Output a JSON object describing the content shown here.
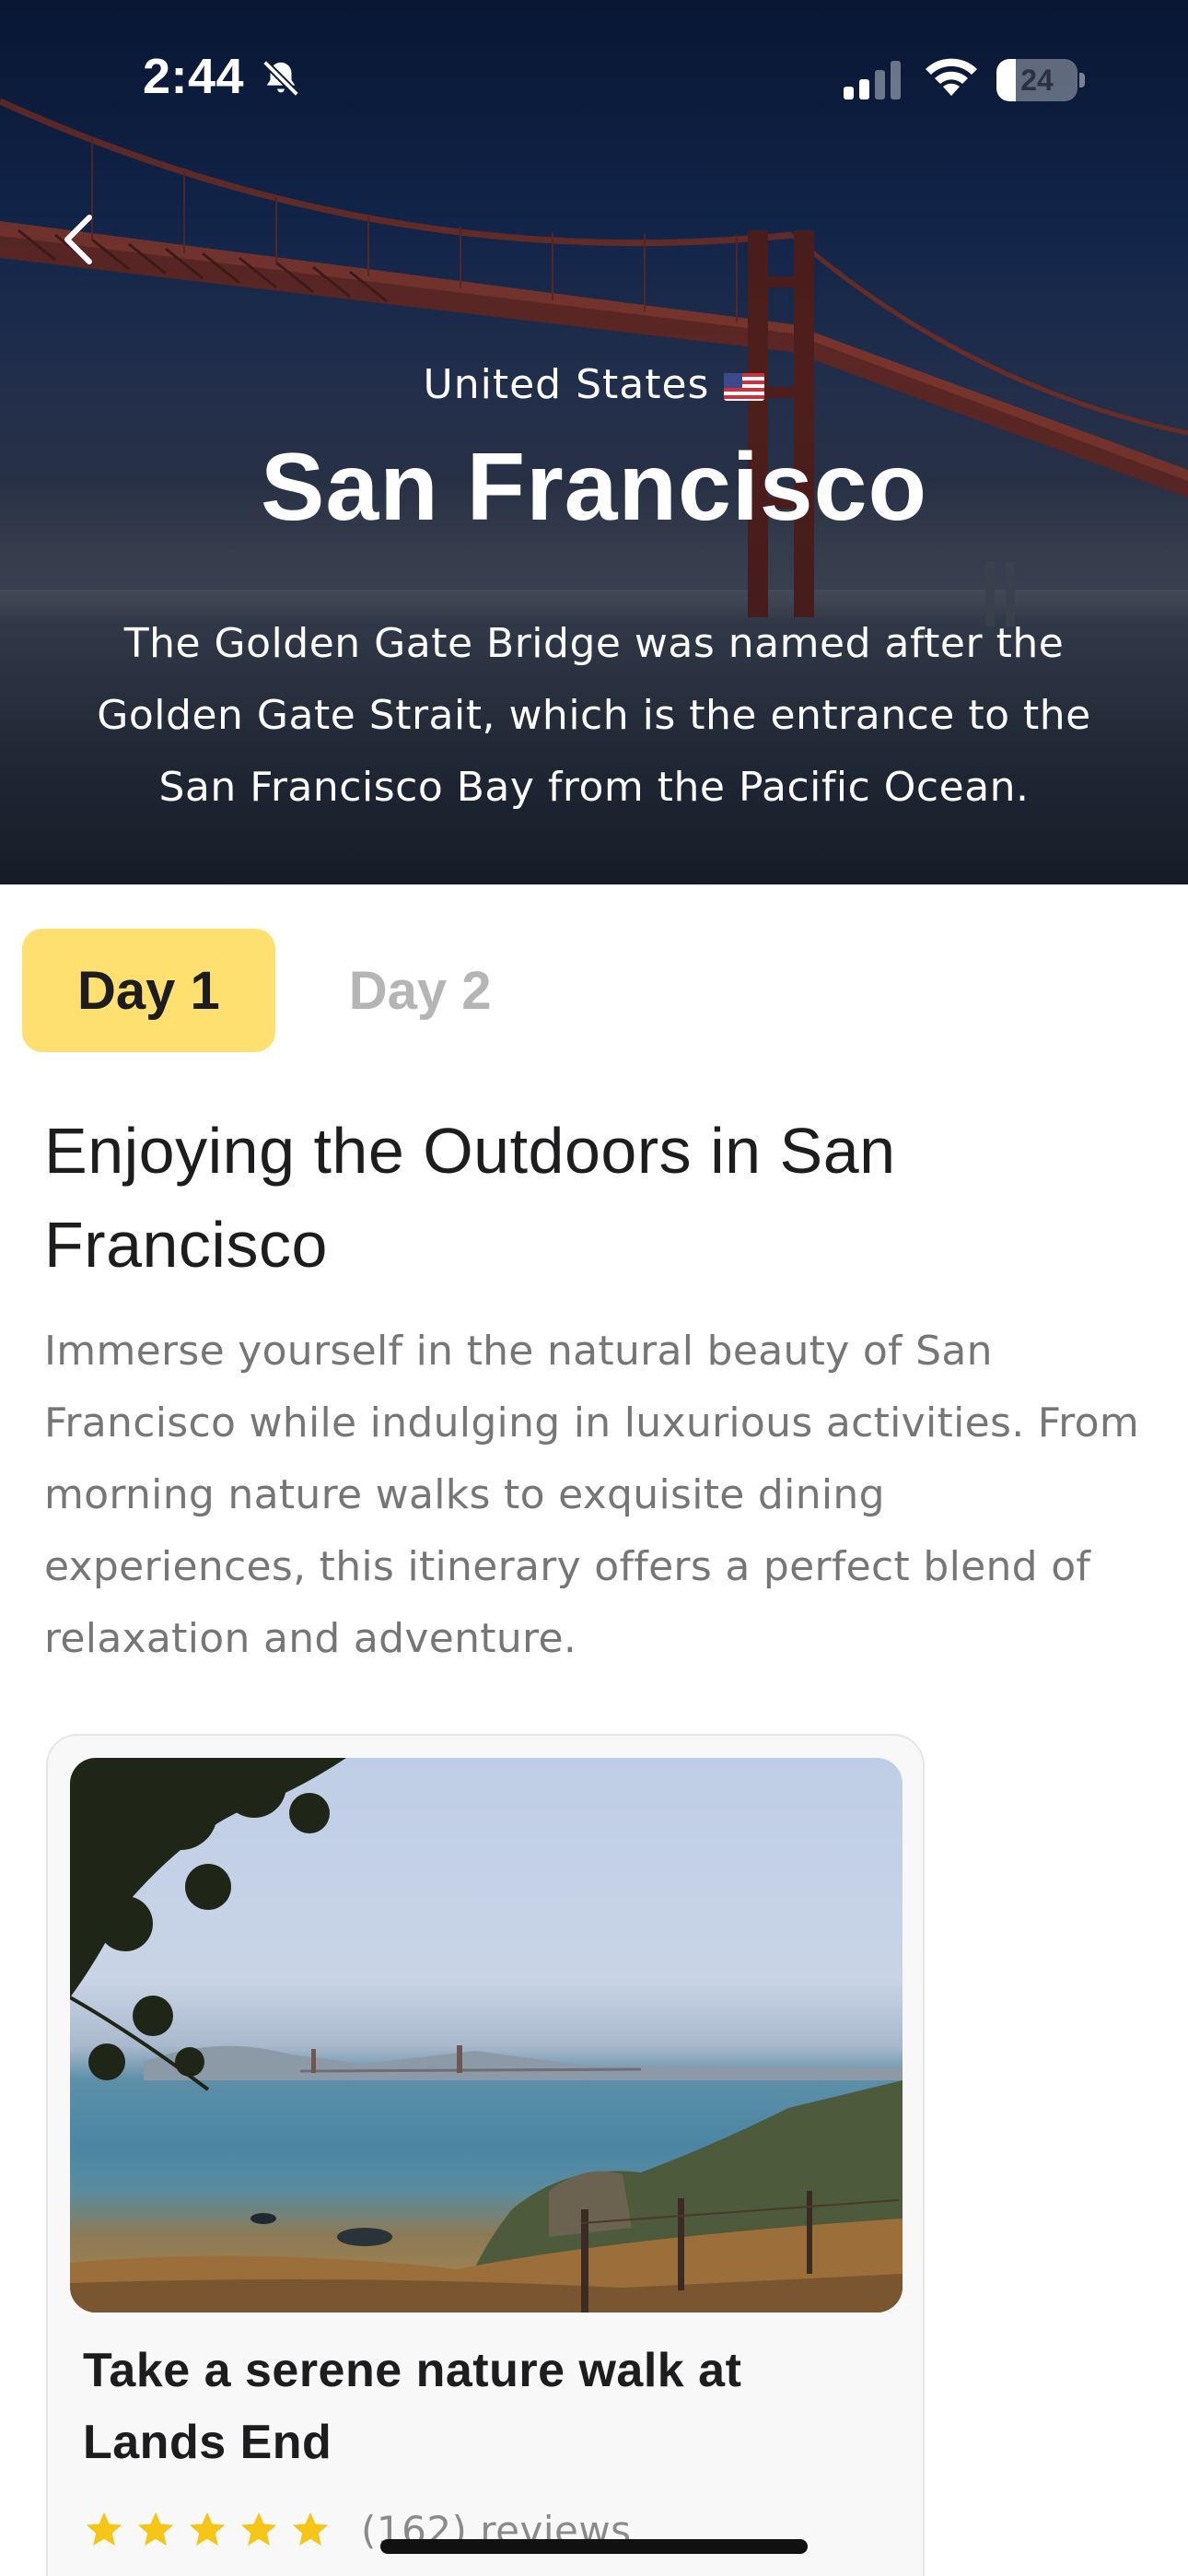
{
  "status_bar": {
    "time": "2:44",
    "battery_level": 24,
    "battery_text": "24",
    "icons": [
      "bell-slash-icon",
      "cellular-signal-icon",
      "wifi-icon",
      "battery-icon"
    ]
  },
  "hero": {
    "country": "United States",
    "flag": "us-flag-icon",
    "city": "San Francisco",
    "description": "The Golden Gate Bridge was named after the Golden Gate Strait, which is the entrance to the San Francisco Bay from the Pacific Ocean."
  },
  "tabs": [
    {
      "label": "Day 1",
      "active": true
    },
    {
      "label": "Day 2",
      "active": false
    }
  ],
  "day": {
    "title": "Enjoying the Outdoors in San Francisco",
    "description": "Immerse yourself in the natural beauty of San Francisco while indulging in luxurious activities. From morning nature walks to exquisite dining experiences, this itinerary offers a perfect blend of relaxation and adventure."
  },
  "activity": {
    "title": "Take a serene nature walk at Lands End",
    "rating": 5,
    "reviews": "(162) reviews"
  },
  "colors": {
    "accent_tab": "#fde070",
    "star": "#f5c518",
    "inactive_tab_text": "#b5b5b5"
  }
}
